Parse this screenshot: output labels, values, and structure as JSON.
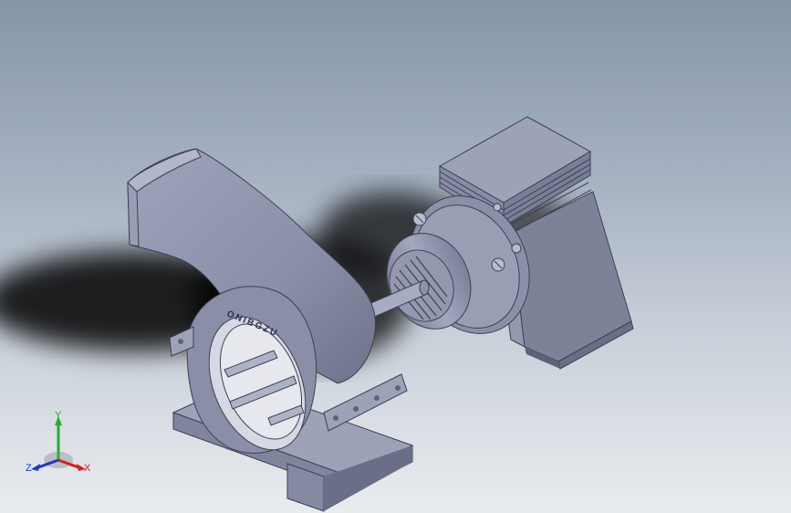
{
  "viewport": {
    "background_top": "#8795a8",
    "background_bottom": "#e9ecef",
    "model_color": "#8e93ab",
    "model_dark": "#5e627a",
    "model_light": "#b9bdd0"
  },
  "model": {
    "name_icon": "pump-assembly-3d-model",
    "housing_engraving": "ONIBGZU"
  },
  "triad": {
    "icon": "coordinate-triad-icon",
    "x_label": "X",
    "y_label": "Y",
    "z_label": "Z",
    "x_color": "#d62020",
    "y_color": "#2faa2f",
    "z_color": "#2038c8"
  }
}
